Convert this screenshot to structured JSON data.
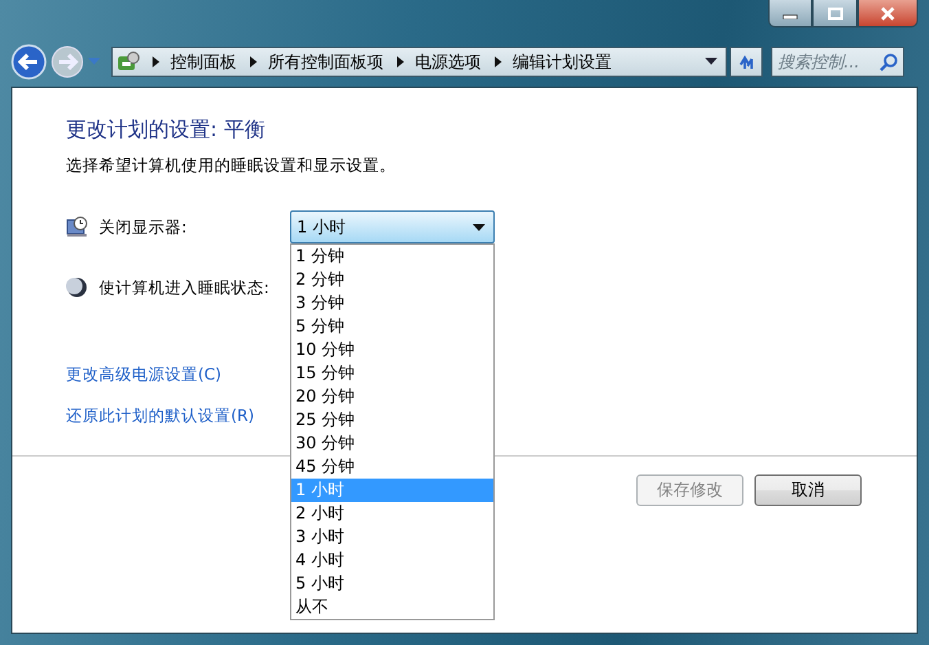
{
  "navigation": {
    "breadcrumbs": [
      "控制面板",
      "所有控制面板项",
      "电源选项",
      "编辑计划设置"
    ],
    "search": {
      "placeholder": "搜索控制..."
    }
  },
  "heading": "更改计划的设置: 平衡",
  "description": "选择希望计算机使用的睡眠设置和显示设置。",
  "settings": [
    {
      "kind": "display",
      "label": "关闭显示器:",
      "value": "1 小时",
      "expanded": true
    },
    {
      "kind": "sleep",
      "label": "使计算机进入睡眠状态:"
    }
  ],
  "dropdown_options": [
    {
      "label": "1 分钟",
      "selected": false
    },
    {
      "label": "2 分钟",
      "selected": false
    },
    {
      "label": "3 分钟",
      "selected": false
    },
    {
      "label": "5 分钟",
      "selected": false
    },
    {
      "label": "10 分钟",
      "selected": false
    },
    {
      "label": "15 分钟",
      "selected": false
    },
    {
      "label": "20 分钟",
      "selected": false
    },
    {
      "label": "25 分钟",
      "selected": false
    },
    {
      "label": "30 分钟",
      "selected": false
    },
    {
      "label": "45 分钟",
      "selected": false
    },
    {
      "label": "1 小时",
      "selected": true
    },
    {
      "label": "2 小时",
      "selected": false
    },
    {
      "label": "3 小时",
      "selected": false
    },
    {
      "label": "4 小时",
      "selected": false
    },
    {
      "label": "5 小时",
      "selected": false
    },
    {
      "label": "从不",
      "selected": false
    }
  ],
  "links": [
    "更改高级电源设置(C)",
    "还原此计划的默认设置(R)"
  ],
  "buttons": [
    {
      "label": "保存修改",
      "disabled": true
    },
    {
      "label": "取消",
      "disabled": false
    }
  ]
}
